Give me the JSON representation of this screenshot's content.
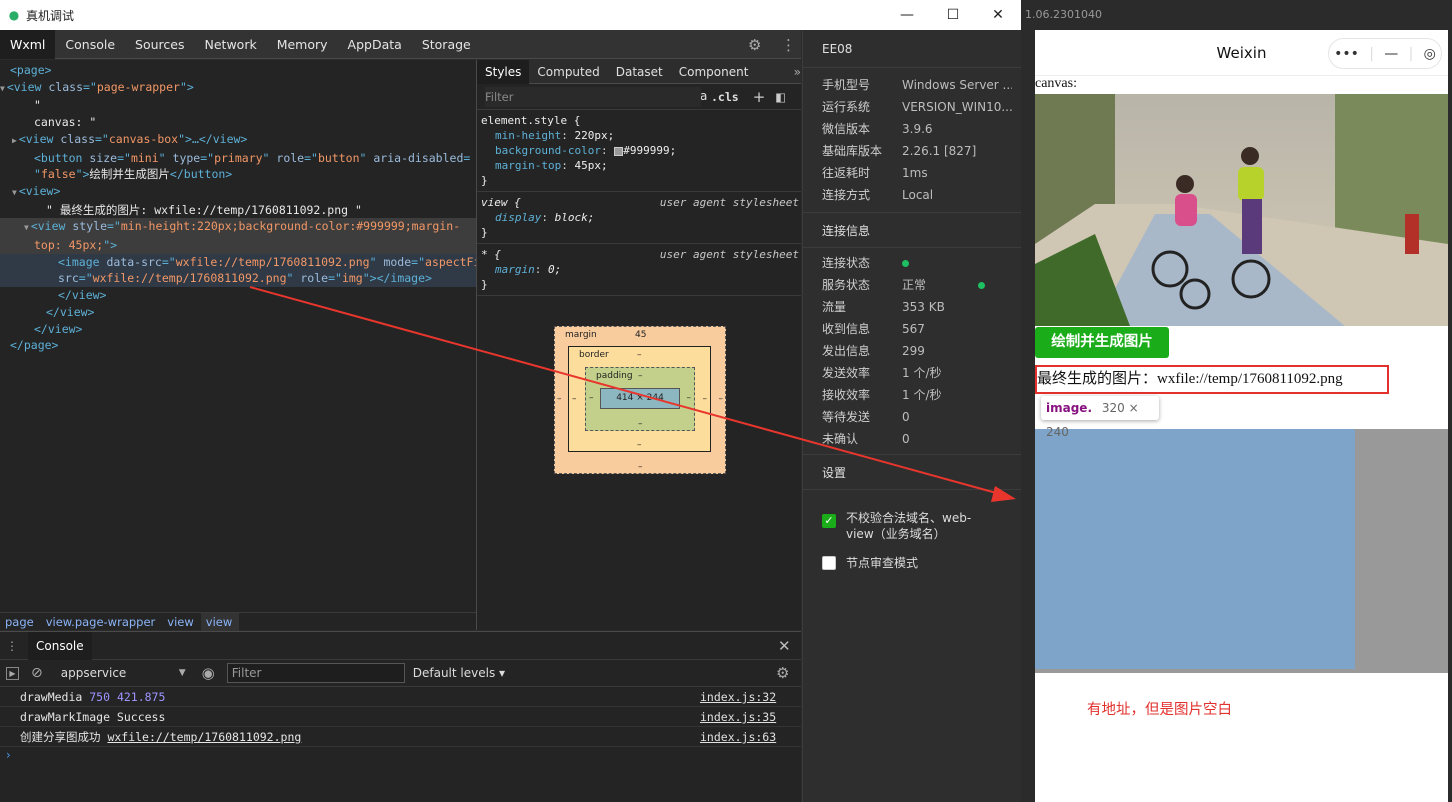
{
  "window": {
    "title": "真机调试",
    "minimize": "—",
    "maximize": "☐",
    "close": "✕"
  },
  "devtools_tabs": [
    "Wxml",
    "Console",
    "Sources",
    "Network",
    "Memory",
    "AppData",
    "Storage"
  ],
  "wxml_lines": [
    {
      "indent": 0,
      "parts": [
        [
          "tag",
          "<page>"
        ]
      ]
    },
    {
      "indent": 0,
      "tri": "▼",
      "parts": [
        [
          "tag",
          "<view "
        ],
        [
          "an",
          "class"
        ],
        [
          "tag",
          "=\""
        ],
        [
          "av",
          "page-wrapper"
        ],
        [
          "tag",
          "\">"
        ]
      ]
    },
    {
      "indent": 2,
      "parts": [
        [
          "tx",
          "\""
        ]
      ]
    },
    {
      "indent": 2,
      "parts": [
        [
          "tx",
          "canvas: \""
        ]
      ]
    },
    {
      "indent": 1,
      "tri": "▶",
      "parts": [
        [
          "tag",
          "<view "
        ],
        [
          "an",
          "class"
        ],
        [
          "tag",
          "=\""
        ],
        [
          "av",
          "canvas-box"
        ],
        [
          "tag",
          "\">…</view>"
        ]
      ]
    },
    {
      "indent": 2,
      "parts": [
        [
          "tag",
          "<button "
        ],
        [
          "an",
          "size"
        ],
        [
          "tag",
          "=\""
        ],
        [
          "av",
          "mini"
        ],
        [
          "tag",
          "\" "
        ],
        [
          "an",
          "type"
        ],
        [
          "tag",
          "=\""
        ],
        [
          "av",
          "primary"
        ],
        [
          "tag",
          "\" "
        ],
        [
          "an",
          "role"
        ],
        [
          "tag",
          "=\""
        ],
        [
          "av",
          "button"
        ],
        [
          "tag",
          "\" "
        ],
        [
          "an",
          "aria-disabled"
        ],
        [
          "tag",
          "="
        ]
      ]
    },
    {
      "indent": 2,
      "parts": [
        [
          "tag",
          "\""
        ],
        [
          "av",
          "false"
        ],
        [
          "tag",
          "\">"
        ],
        [
          "tx",
          "绘制并生成图片"
        ],
        [
          "tag",
          "</button>"
        ]
      ]
    },
    {
      "indent": 1,
      "tri": "▼",
      "parts": [
        [
          "tag",
          "<view>"
        ]
      ]
    },
    {
      "indent": 3,
      "parts": [
        [
          "tx",
          "\" 最终生成的图片: wxfile://temp/1760811092.png \""
        ]
      ]
    },
    {
      "indent": 2,
      "tri": "▼",
      "cls": "sel",
      "parts": [
        [
          "tag",
          "<view "
        ],
        [
          "an",
          "style"
        ],
        [
          "tag",
          "=\""
        ],
        [
          "av",
          "min-height:220px;background-color:#999999;margin-"
        ]
      ]
    },
    {
      "indent": 2,
      "cls": "sel",
      "parts": [
        [
          "av",
          "top: 45px;"
        ],
        [
          "tag",
          "\">"
        ]
      ]
    },
    {
      "indent": 4,
      "cls": "sel2",
      "parts": [
        [
          "tag",
          "<image "
        ],
        [
          "an",
          "data-src"
        ],
        [
          "tag",
          "=\""
        ],
        [
          "av",
          "wxfile://temp/1760811092.png"
        ],
        [
          "tag",
          "\" "
        ],
        [
          "an",
          "mode"
        ],
        [
          "tag",
          "=\""
        ],
        [
          "av",
          "aspectFit"
        ]
      ]
    },
    {
      "indent": 4,
      "cls": "sel2",
      "parts": [
        [
          "an",
          "src"
        ],
        [
          "tag",
          "=\""
        ],
        [
          "av",
          "wxfile://temp/1760811092.png"
        ],
        [
          "tag",
          "\" "
        ],
        [
          "an",
          "role"
        ],
        [
          "tag",
          "=\""
        ],
        [
          "av",
          "img"
        ],
        [
          "tag",
          "\"></image>"
        ]
      ]
    },
    {
      "indent": 4,
      "parts": [
        [
          "tag",
          "</view>"
        ]
      ]
    },
    {
      "indent": 3,
      "parts": [
        [
          "tag",
          "</view>"
        ]
      ]
    },
    {
      "indent": 2,
      "parts": [
        [
          "tag",
          "</view>"
        ]
      ]
    },
    {
      "indent": 0,
      "parts": [
        [
          "tag",
          "</page>"
        ]
      ]
    }
  ],
  "breadcrumbs": [
    "page",
    "view.page-wrapper",
    "view",
    "view"
  ],
  "styles_tabs": [
    "Styles",
    "Computed",
    "Dataset",
    "Component Data"
  ],
  "styles_filter": {
    "placeholder": "Filter",
    "cls": ".cls",
    "plus": "+"
  },
  "rules": {
    "element": {
      "selector": "element.style {",
      "props": [
        [
          "min-height",
          "220px;"
        ],
        [
          "background-color",
          "#999999;"
        ],
        [
          "margin-top",
          "45px;"
        ]
      ],
      "close": "}"
    },
    "view": {
      "selector": "view {",
      "source": "user agent stylesheet",
      "props": [
        [
          "display",
          "block;"
        ]
      ],
      "close": "}"
    },
    "star": {
      "selector": "* {",
      "source": "user agent stylesheet",
      "props": [
        [
          "margin",
          "0;"
        ]
      ],
      "close": "}"
    }
  },
  "boxmodel": {
    "margin": "margin",
    "margin_top": "45",
    "border": "border",
    "padding": "padding",
    "content": "414 × 244",
    "dash": "–"
  },
  "info": {
    "device": "EE08",
    "rows": [
      [
        "手机型号",
        "Windows Server ..."
      ],
      [
        "运行系统",
        "VERSION_WIN10..."
      ],
      [
        "微信版本",
        "3.9.6"
      ],
      [
        "基础库版本",
        "2.26.1 [827]"
      ],
      [
        "往返耗时",
        "1ms"
      ],
      [
        "连接方式",
        "Local"
      ]
    ],
    "conn_title": "连接信息",
    "conn_rows": [
      [
        "连接状态",
        ""
      ],
      [
        "服务状态",
        "正常"
      ],
      [
        "流量",
        "353 KB"
      ],
      [
        "收到信息",
        "567"
      ],
      [
        "发出信息",
        "299"
      ],
      [
        "发送效率",
        "1 个/秒"
      ],
      [
        "接收效率",
        "1 个/秒"
      ],
      [
        "等待发送",
        "0"
      ],
      [
        "未确认",
        "0"
      ]
    ],
    "settings_title": "设置",
    "opt1": "不校验合法域名、web-view（业务域名）",
    "opt2": "节点审查模式",
    "opt1_checked": true,
    "opt2_checked": false,
    "accent": "#1aad19"
  },
  "console": {
    "tab": "Console",
    "context": "appservice",
    "filter_placeholder": "Filter",
    "levels": "Default levels ▾",
    "lines": [
      {
        "text": "drawMedia",
        "num": "750 421.875",
        "loc": "index.js:32"
      },
      {
        "text": "drawMarkImage Success",
        "num": "",
        "loc": "index.js:35"
      },
      {
        "text": "创建分享图成功",
        "link": "wxfile://temp/1760811092.png",
        "loc": "index.js:63"
      }
    ],
    "prompt": "›"
  },
  "sim": {
    "version": "1.06.2301040",
    "nav_title": "Weixin",
    "canvas_label": "canvas:",
    "gen_button": "绘制并生成图片",
    "final_text": "最终生成的图片：wxfile://temp/1760811092.png",
    "tip_tag": "image.",
    "tip_size": "320 × 240",
    "note": "有地址，但是图片空白"
  }
}
